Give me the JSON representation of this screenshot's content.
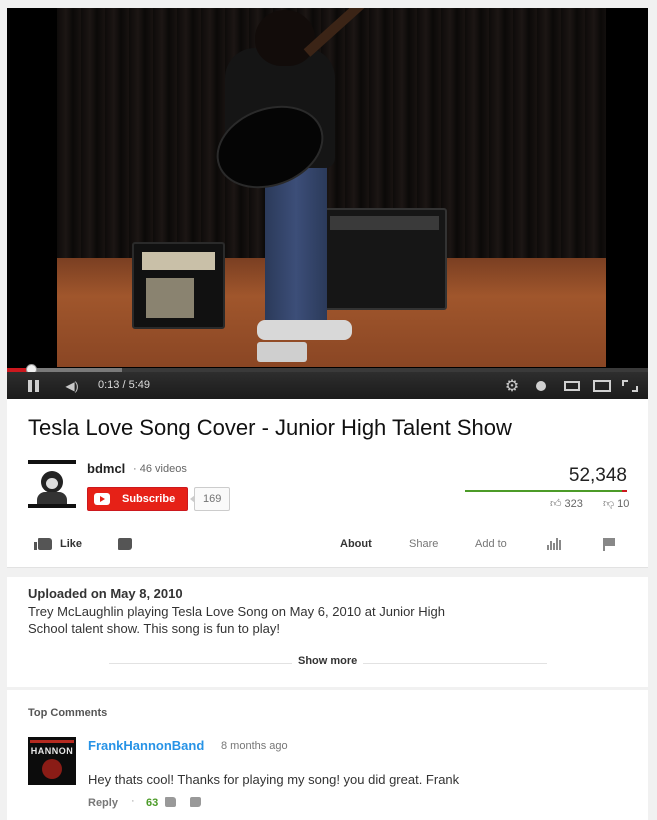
{
  "player": {
    "time_display": "0:13 / 5:49",
    "progress_fraction": 0.0372,
    "loaded_fraction": 0.18
  },
  "video": {
    "title": "Tesla Love Song Cover - Junior High Talent Show",
    "views": "52,348",
    "likes": "323",
    "dislikes": "10",
    "like_ratio": 0.97
  },
  "channel": {
    "name": "bdmcl",
    "video_count": "46 videos",
    "subscribe_label": "Subscribe",
    "subscriber_count": "169"
  },
  "actions": {
    "like_label": "Like",
    "about_label": "About",
    "share_label": "Share",
    "add_to_label": "Add to"
  },
  "description": {
    "upload_date": "Uploaded on May 8, 2010",
    "text": "Trey McLaughlin playing Tesla Love Song on May 6, 2010 at Junior High School talent show. This song is fun to play!",
    "show_more_label": "Show more"
  },
  "comments": {
    "heading": "Top Comments",
    "items": [
      {
        "author": "FrankHannonBand",
        "time": "8 months ago",
        "text": "Hey thats cool! Thanks for playing my song! you did great. Frank",
        "reply_label": "Reply",
        "separator": "·",
        "likes": "63",
        "avatar_text": "HANNON"
      }
    ]
  },
  "colors": {
    "accent_red": "#e62117",
    "link_blue": "#2793e6",
    "like_green": "#4c9b28"
  }
}
